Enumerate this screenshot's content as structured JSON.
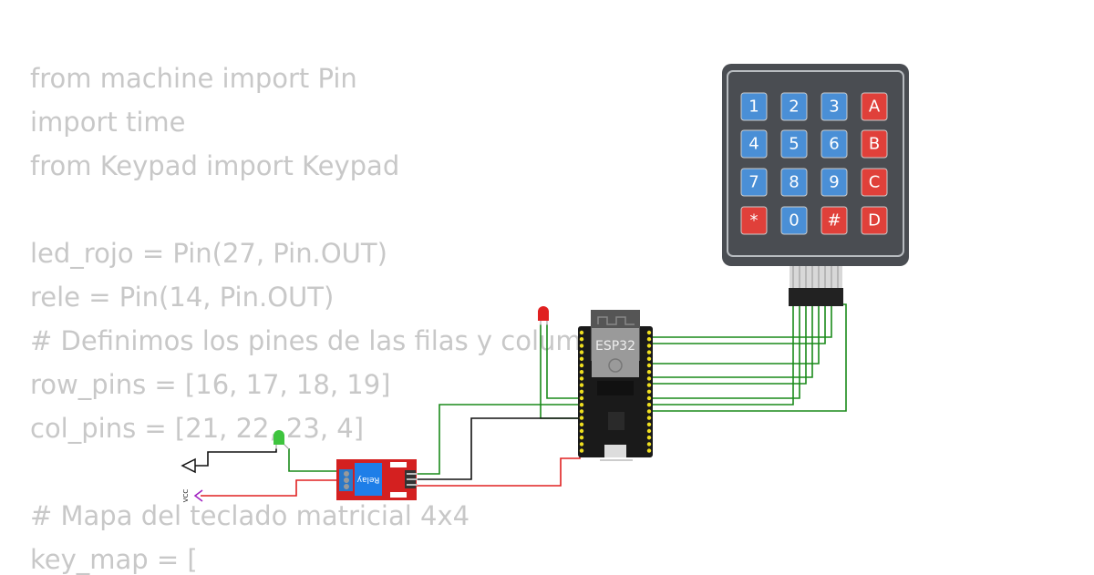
{
  "code_lines": [
    "from machine import Pin",
    "import time",
    "from Keypad import Keypad",
    "",
    "led_rojo = Pin(27, Pin.OUT)",
    "rele = Pin(14, Pin.OUT)",
    "# Definimos los pines de las filas y columnas",
    "row_pins = [16, 17, 18, 19]",
    "col_pins = [21, 22, 23, 4]",
    "",
    "# Mapa del teclado matricial 4x4",
    "key_map = ["
  ],
  "keypad": {
    "keys": [
      [
        "1",
        "2",
        "3",
        "A"
      ],
      [
        "4",
        "5",
        "6",
        "B"
      ],
      [
        "7",
        "8",
        "9",
        "C"
      ],
      [
        "*",
        "0",
        "#",
        "D"
      ]
    ],
    "colors": {
      "digit": "#4a8fd6",
      "function": "#e0403a",
      "body": "#4a4d52"
    }
  },
  "esp32": {
    "label": "ESP32"
  },
  "relay": {
    "label": "Relay"
  },
  "power": {
    "vcc_label": "VCC"
  },
  "colors": {
    "wire_green": "#1a8a1a",
    "wire_red": "#e02020",
    "wire_black": "#111111",
    "led_red": "#e02020",
    "led_green": "#3ec43e",
    "relay_board": "#d42020"
  }
}
